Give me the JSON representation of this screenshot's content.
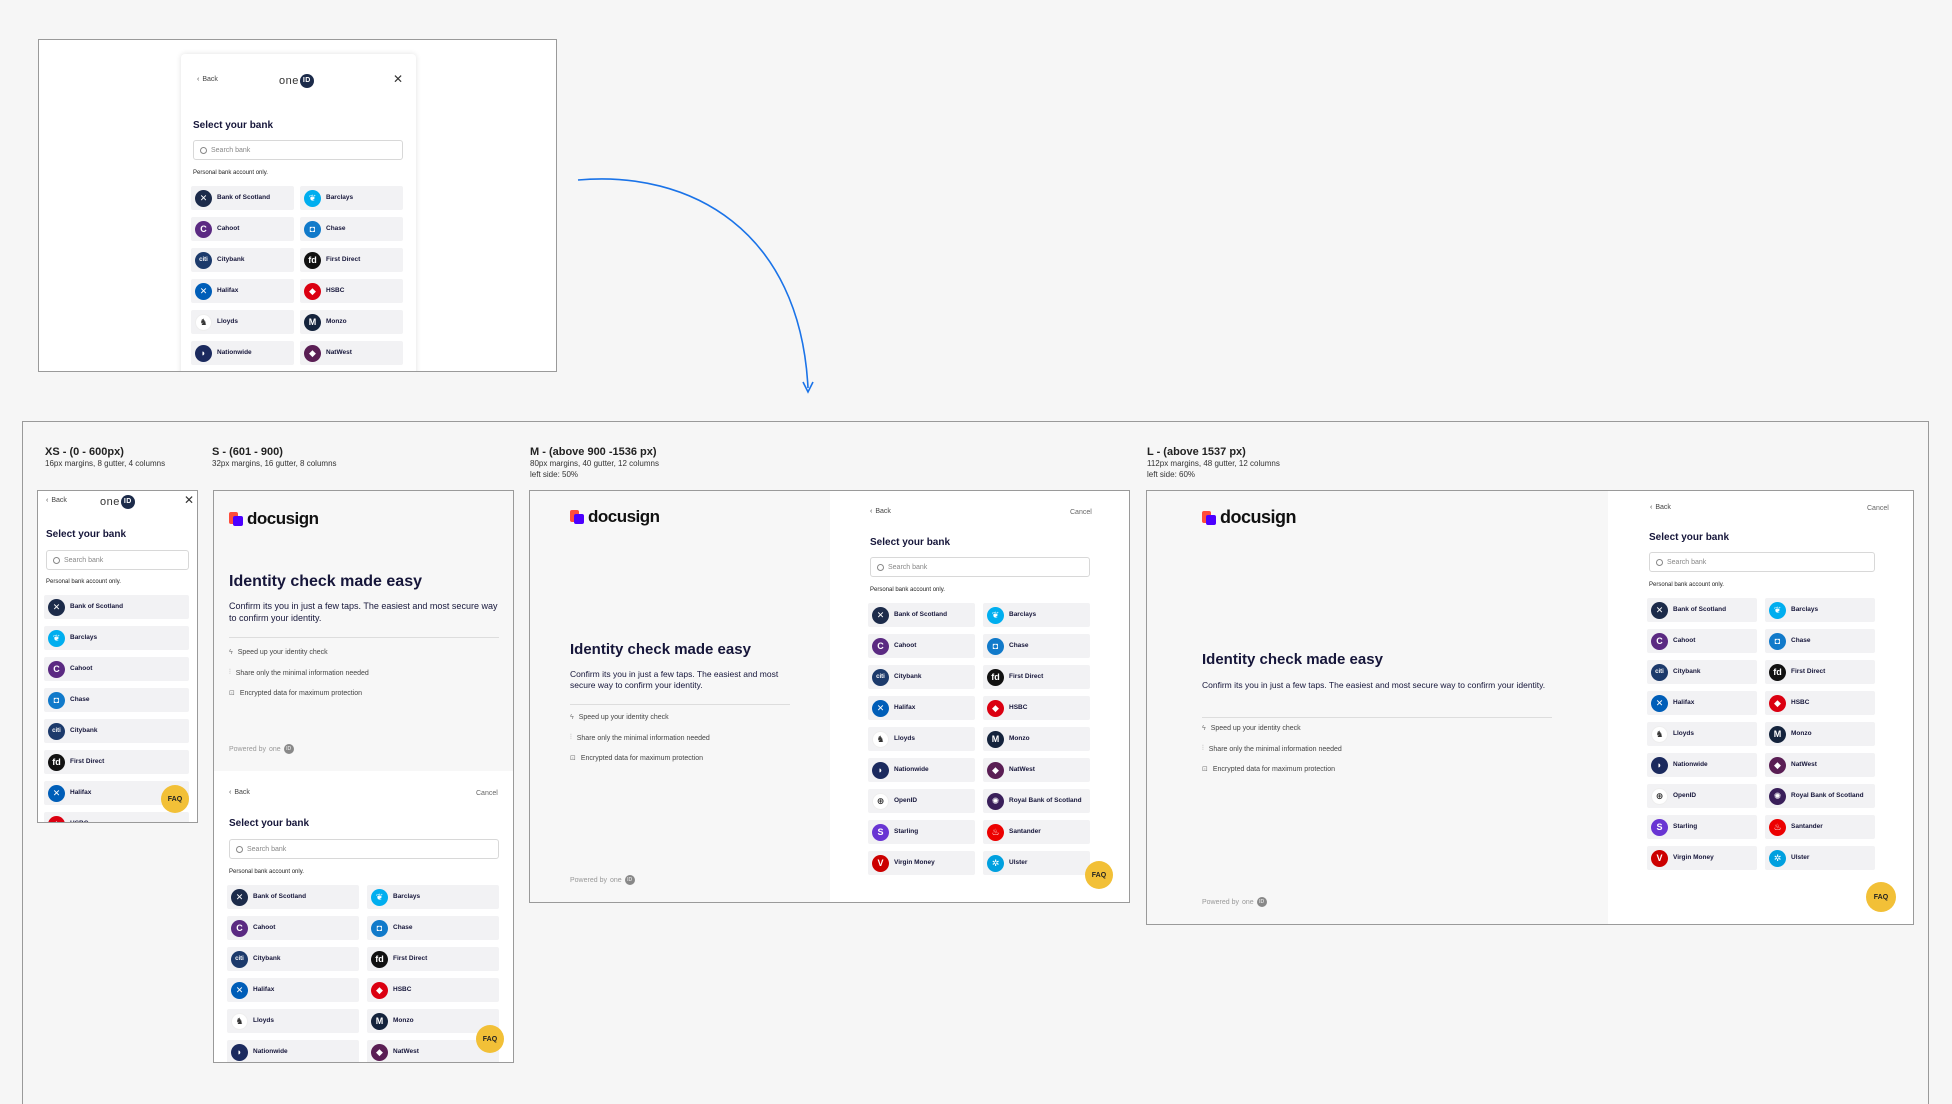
{
  "nav": {
    "back": "Back",
    "cancel": "Cancel",
    "close_icon": "close-icon"
  },
  "brand": {
    "oneid_text": "one",
    "oneid_badge": "ID",
    "docusign": "docusign",
    "powered": "Powered by",
    "powered_word": "one"
  },
  "select": {
    "title": "Select your bank",
    "placeholder": "Search bank",
    "note": "Personal bank account only."
  },
  "hero": {
    "title": "Identity check made easy",
    "body": "Confirm its you in just a few taps. The easiest and most secure way to confirm your identity.",
    "features": [
      "Speed up your identity check",
      "Share only the minimal information needed",
      "Encrypted data for maximum protection"
    ]
  },
  "faq": "FAQ",
  "breakpoints": {
    "xs": {
      "title": "XS - (0 - 600px)",
      "sub": "16px margins, 8 gutter, 4 columns"
    },
    "s": {
      "title": "S - (601 - 900)",
      "sub": "32px margins, 16 gutter, 8 columns"
    },
    "m": {
      "title": "M - (above 900 -1536 px)",
      "sub": "80px margins, 40 gutter, 12 columns",
      "sub2": "left side: 50%"
    },
    "l": {
      "title": "L - (above 1537 px)",
      "sub": "112px margins, 48 gutter, 12 columns",
      "sub2": "left side: 60%"
    }
  },
  "banks": [
    {
      "name": "Bank of Scotland",
      "color": "#1c2b4a",
      "glyph": "✕"
    },
    {
      "name": "Barclays",
      "color": "#00aeef",
      "glyph": "❦"
    },
    {
      "name": "Cahoot",
      "color": "#5b2a82",
      "glyph": "C"
    },
    {
      "name": "Chase",
      "color": "#117aca",
      "glyph": "◘"
    },
    {
      "name": "Citybank",
      "color": "#1c3a6b",
      "glyph": "citi"
    },
    {
      "name": "First Direct",
      "color": "#111111",
      "glyph": "fd"
    },
    {
      "name": "Halifax",
      "color": "#005eb8",
      "glyph": "✕"
    },
    {
      "name": "HSBC",
      "color": "#db0011",
      "glyph": "◆"
    },
    {
      "name": "Lloyds",
      "color": "#ffffff",
      "glyph": "♞"
    },
    {
      "name": "Monzo",
      "color": "#14233c",
      "glyph": "M"
    },
    {
      "name": "Nationwide",
      "color": "#1b2a5e",
      "glyph": "◗"
    },
    {
      "name": "NatWest",
      "color": "#5a1e54",
      "glyph": "◆"
    },
    {
      "name": "OpenID",
      "color": "#ffffff",
      "glyph": "⊕"
    },
    {
      "name": "Royal Bank of Scotland",
      "color": "#3a1f5a",
      "glyph": "✺"
    },
    {
      "name": "Starling",
      "color": "#6935d3",
      "glyph": "S"
    },
    {
      "name": "Santander",
      "color": "#ec0000",
      "glyph": "♨"
    },
    {
      "name": "Virgin Money",
      "color": "#cc0000",
      "glyph": "V"
    },
    {
      "name": "Ulster",
      "color": "#00a0df",
      "glyph": "✲"
    }
  ]
}
